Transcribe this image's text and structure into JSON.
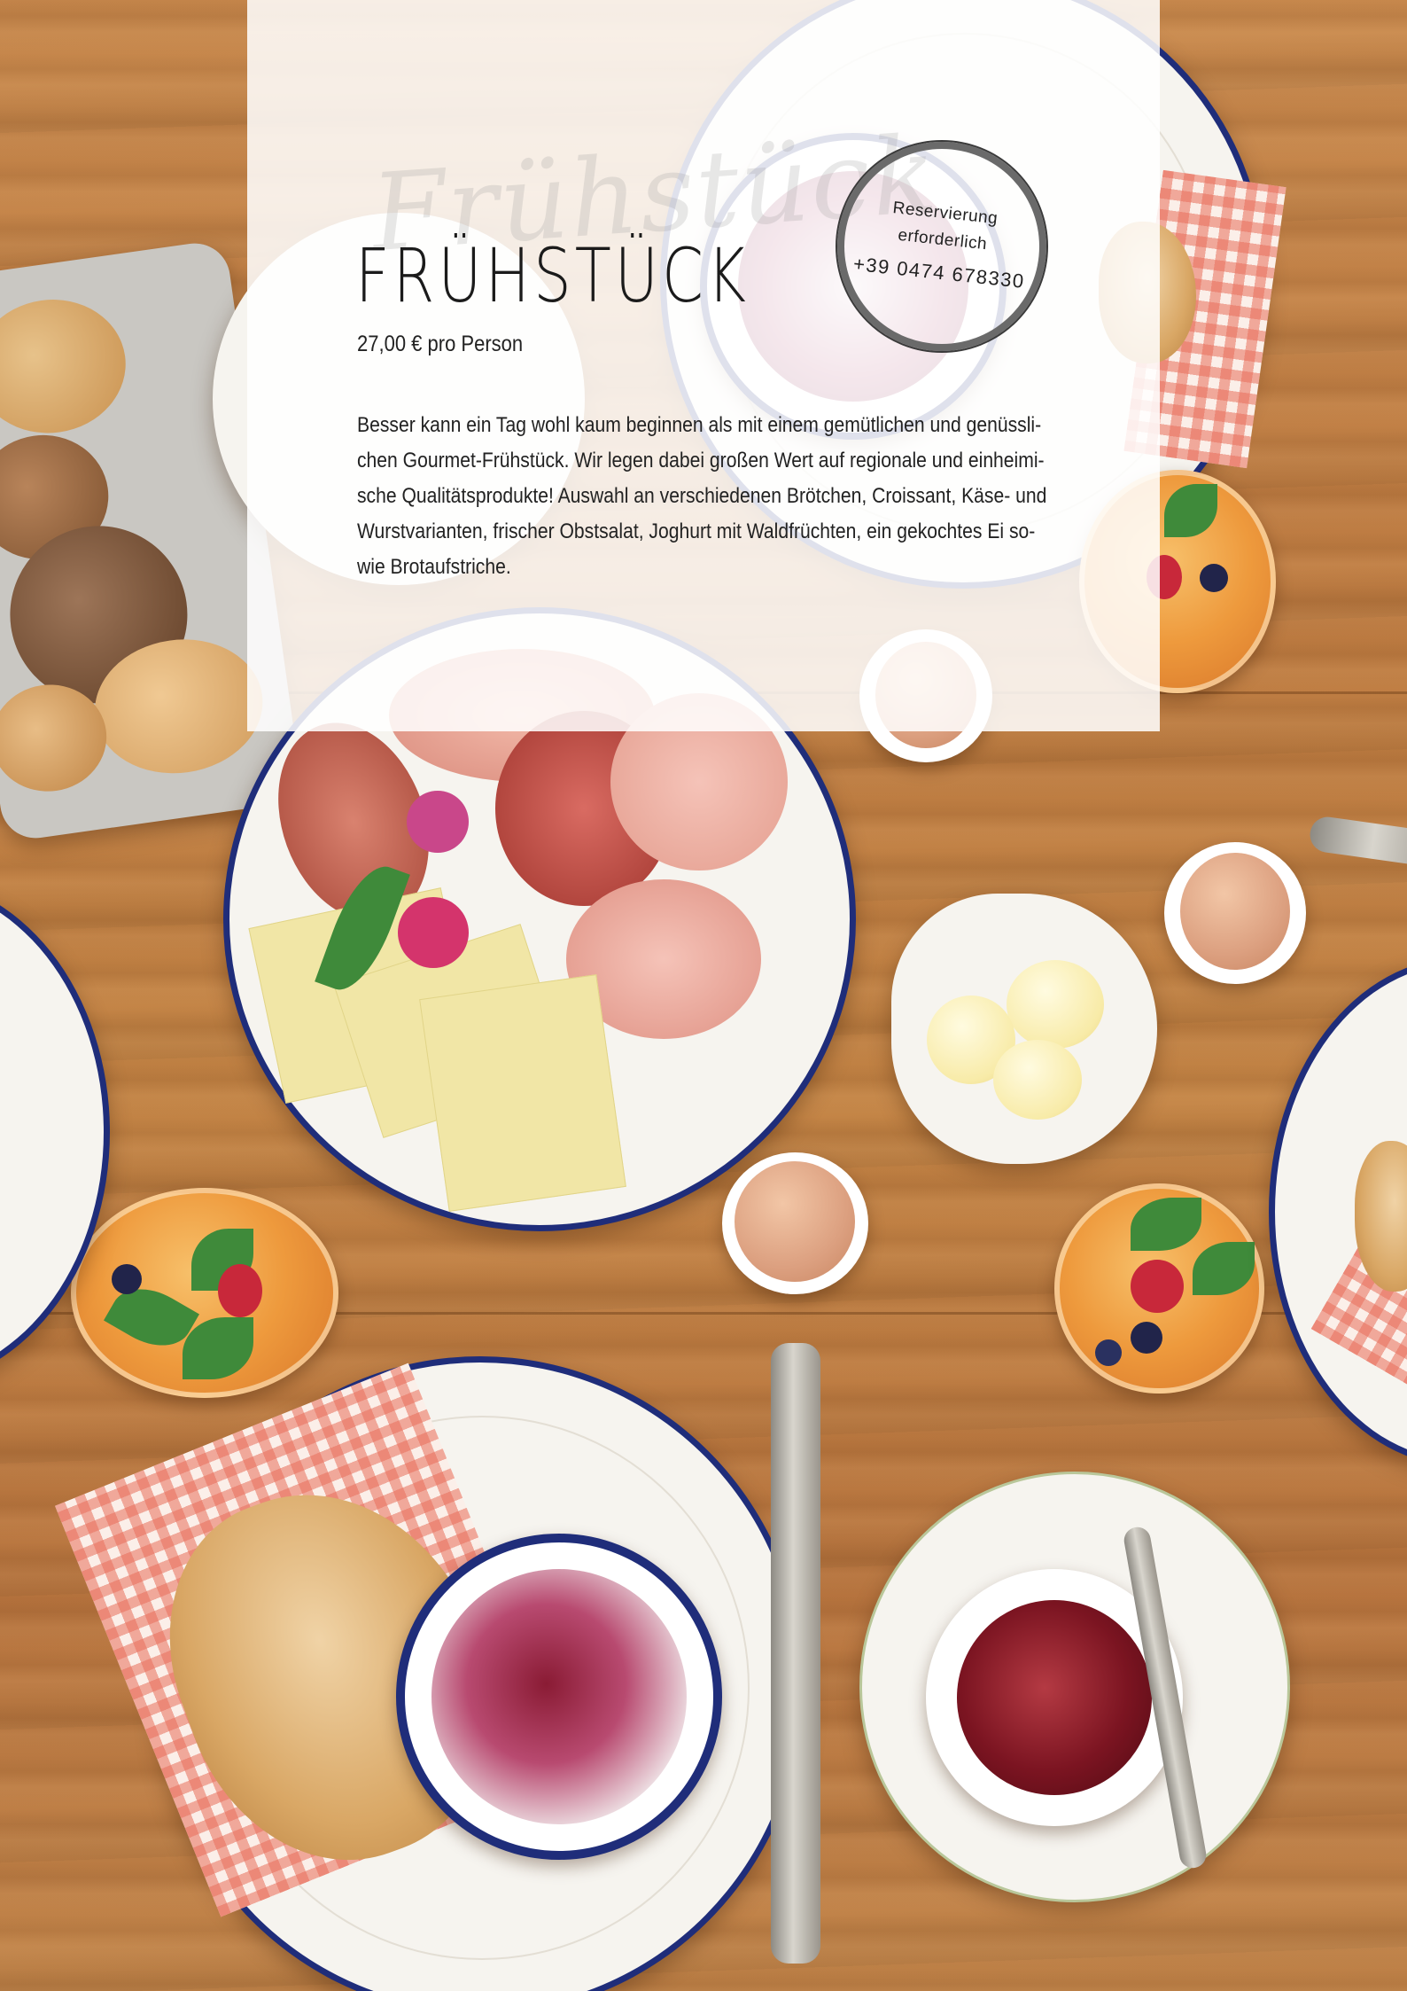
{
  "page": {
    "script_title": "Frühstück",
    "title": "FRÜHSTÜCK",
    "price": "27,00 € pro Person",
    "description_lines": [
      "Besser kann ein Tag wohl kaum beginnen als mit einem gemütlichen und genüssli-",
      "chen Gourmet-Frühstück. Wir legen dabei großen Wert auf regionale und einheimi-",
      "sche Qualitätsprodukte! Auswahl an verschiedenen Brötchen, Croissant, Käse- und",
      "Wurstvarianten, frischer Obstsalat, Joghurt mit Waldfrüchten, ein gekochtes Ei so-",
      "wie Brotaufstriche."
    ]
  },
  "stamp": {
    "line1": "Reservierung",
    "line2": "erforderlich",
    "phone": "+39 0474 678330"
  },
  "colors": {
    "overlay": "#ffffff",
    "text": "#1b1b1b",
    "plate_rim": "#1f2d7a",
    "wood": "#c48546"
  }
}
